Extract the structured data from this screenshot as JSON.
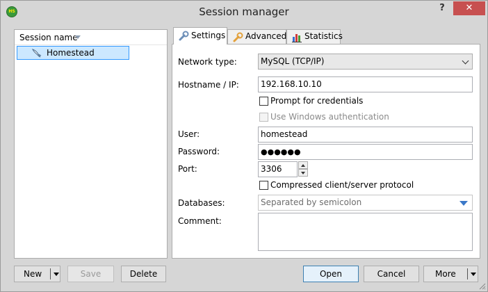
{
  "window": {
    "title": "Session manager",
    "app_icon_text": "HS",
    "help_label": "?",
    "close_label": "✕"
  },
  "sessions": {
    "column_header": "Session name",
    "items": [
      {
        "label": "Homestead",
        "selected": true
      }
    ]
  },
  "tabs": [
    {
      "label": "Settings",
      "icon": "wrench-icon",
      "active": true
    },
    {
      "label": "Advanced",
      "icon": "wrench-orange-icon",
      "active": false
    },
    {
      "label": "Statistics",
      "icon": "bar-chart-icon",
      "active": false
    }
  ],
  "settings": {
    "network_type_label": "Network type:",
    "network_type_value": "MySQL (TCP/IP)",
    "hostname_label": "Hostname / IP:",
    "hostname_value": "192.168.10.10",
    "prompt_credentials_label": "Prompt for credentials",
    "prompt_credentials_checked": false,
    "windows_auth_label": "Use Windows authentication",
    "windows_auth_checked": false,
    "user_label": "User:",
    "user_value": "homestead",
    "password_label": "Password:",
    "password_value": "●●●●●●",
    "port_label": "Port:",
    "port_value": "3306",
    "compressed_label": "Compressed client/server protocol",
    "compressed_checked": false,
    "databases_label": "Databases:",
    "databases_placeholder": "Separated by semicolon",
    "comment_label": "Comment:",
    "comment_value": ""
  },
  "buttons": {
    "new": "New",
    "save": "Save",
    "delete": "Delete",
    "open": "Open",
    "cancel": "Cancel",
    "more": "More"
  },
  "colors": {
    "close": "#c75050",
    "selection": "#cce8ff",
    "selection_border": "#3399ff",
    "accent": "#3c7fb1"
  }
}
